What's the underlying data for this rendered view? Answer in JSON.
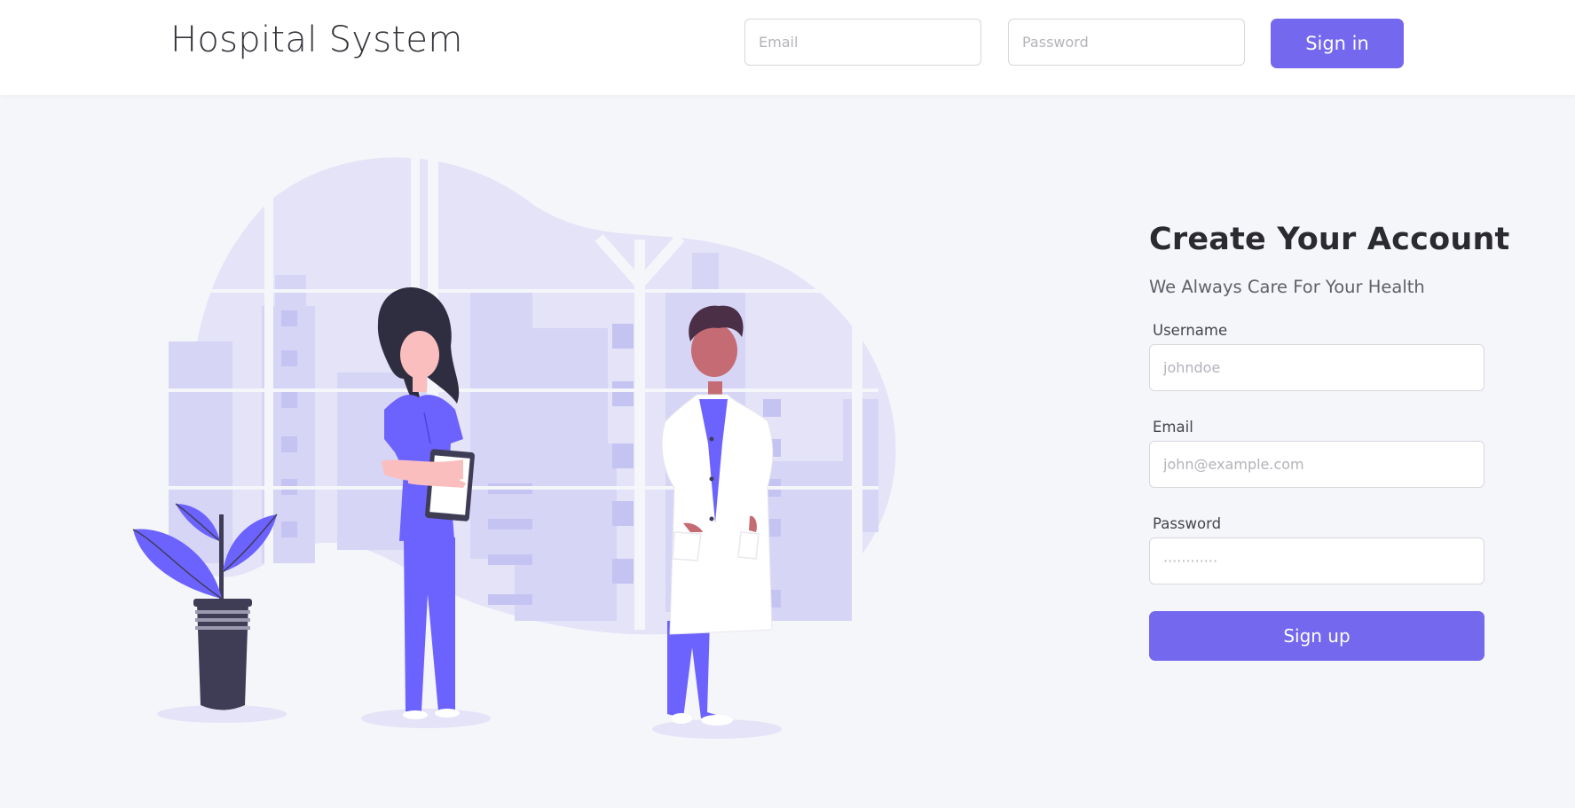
{
  "header": {
    "brand": "Hospital System",
    "email_placeholder": "Email",
    "password_placeholder": "Password",
    "signin_label": "Sign in"
  },
  "form": {
    "title": "Create Your Account",
    "subtitle": "We Always Care For Your Health",
    "username_label": "Username",
    "username_placeholder": "johndoe",
    "email_label": "Email",
    "email_placeholder": "john@example.com",
    "password_label": "Password",
    "password_placeholder": "············",
    "signup_label": "Sign up"
  },
  "colors": {
    "accent": "#7468ee",
    "background": "#f5f6fa",
    "illustration_purple": "#6c63ff",
    "illustration_dark": "#3f3d56",
    "blob": "#e4e3f8"
  }
}
